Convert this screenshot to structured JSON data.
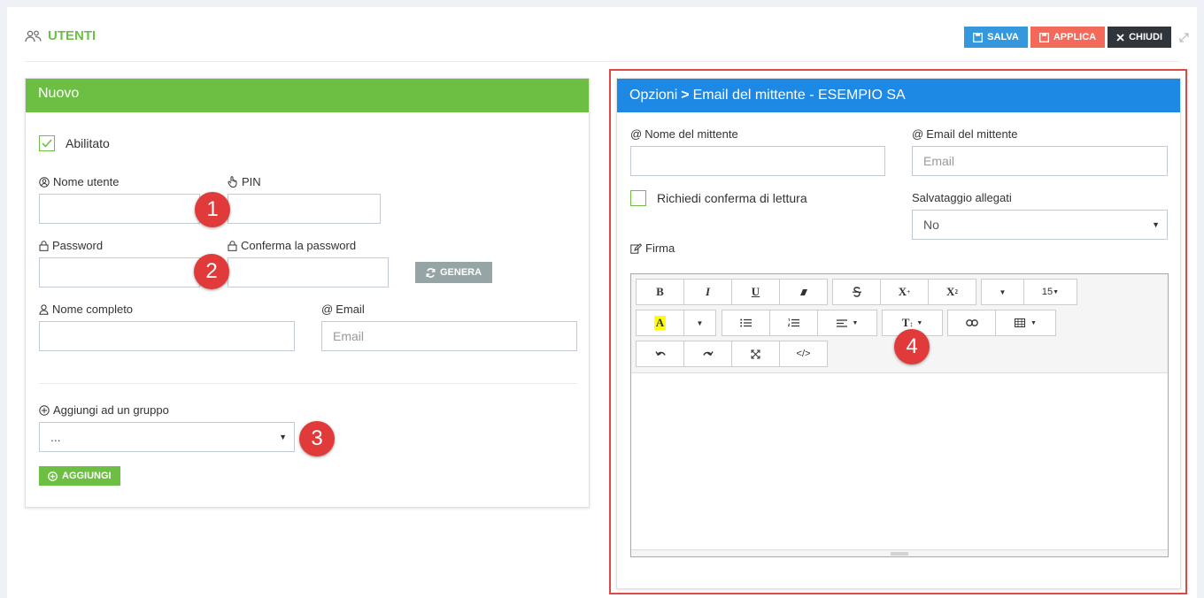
{
  "header": {
    "title": "UTENTI",
    "buttons": {
      "salva": "SALVA",
      "applica": "APPLICA",
      "chiudi": "CHIUDI"
    }
  },
  "left_panel": {
    "title": "Nuovo",
    "enabled_label": "Abilitato",
    "username_label": "Nome utente",
    "pin_label": "PIN",
    "password_label": "Password",
    "confirm_password_label": "Conferma la password",
    "generate_button": "GENERA",
    "fullname_label": "Nome completo",
    "email_label": "Email",
    "email_placeholder": "Email",
    "add_group_label": "Aggiungi ad un gruppo",
    "group_select_value": "...",
    "add_button": "AGGIUNGI"
  },
  "right_panel": {
    "title_part1": "Opzioni",
    "title_part2": "Email del mittente - ESEMPIO SA",
    "sender_name_label": "Nome del mittente",
    "sender_email_label": "Email del mittente",
    "sender_email_placeholder": "Email",
    "read_receipt_label": "Richiedi conferma di lettura",
    "attachments_label": "Salvataggio allegati",
    "attachments_value": "No",
    "signature_label": "Firma"
  },
  "editor_toolbar": {
    "bold": "B",
    "italic": "I",
    "underline": "U",
    "superscript": "X",
    "subscript": "X",
    "font_size": "15",
    "highlight": "A",
    "code": "</>"
  },
  "annotations": [
    "1",
    "2",
    "3",
    "4"
  ],
  "colors": {
    "green": "#6cbf43",
    "blue": "#1e88e5",
    "salva": "#3598dc",
    "applica": "#f36a5a",
    "chiudi": "#2f353b",
    "badge": "#e03a3a"
  }
}
